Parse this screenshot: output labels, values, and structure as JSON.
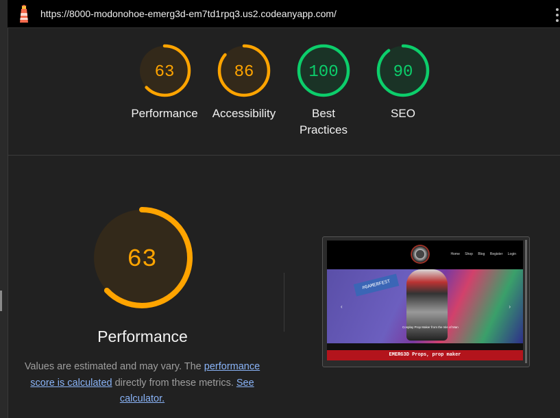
{
  "browser": {
    "url": "https://8000-modonohoe-emerg3d-em7td1rpq3.us2.codeanyapp.com/"
  },
  "categories": [
    {
      "label": "Performance",
      "score": 63,
      "color": "#ffa400",
      "bg": "#33291a"
    },
    {
      "label": "Accessibility",
      "score": 86,
      "color": "#ffa400",
      "bg": "#33291a"
    },
    {
      "label": "Best Practices",
      "score": 100,
      "color": "#0cce6b",
      "bg": "#1a3326"
    },
    {
      "label": "SEO",
      "score": 90,
      "color": "#0cce6b",
      "bg": "#1a3326"
    }
  ],
  "performance": {
    "score": 63,
    "title": "Performance",
    "desc_prefix": "Values are estimated and may vary. The ",
    "link1": "performance score is calculated",
    "desc_middle": " directly from these metrics. ",
    "link2": "See calculator."
  },
  "screenshot": {
    "nav": [
      "Home",
      "Shop",
      "Blog",
      "Register",
      "Login"
    ],
    "hero_sign": "#GAMERFEST",
    "hero_caption": "Cosplay Prop Maker from the Isle of Man",
    "banner": "EMERG3D Props, prop maker"
  }
}
